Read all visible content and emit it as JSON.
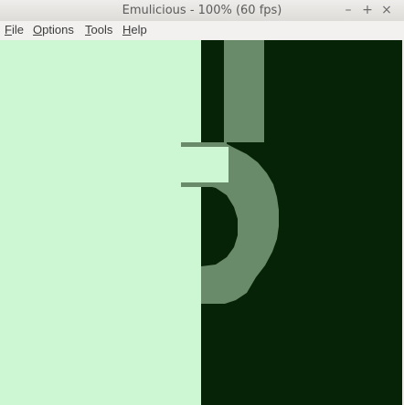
{
  "window": {
    "title": "Emulicious - 100% (60 fps)",
    "controls": {
      "minimize": "–",
      "maximize": "+",
      "close": "×"
    }
  },
  "menubar": {
    "items": [
      {
        "label": "File"
      },
      {
        "label": "Options"
      },
      {
        "label": "Tools"
      },
      {
        "label": "Help"
      }
    ]
  },
  "screen": {
    "palette": {
      "lightest": "#cdf7d2",
      "mid": "#6a8b69",
      "darkest": "#072307"
    }
  }
}
